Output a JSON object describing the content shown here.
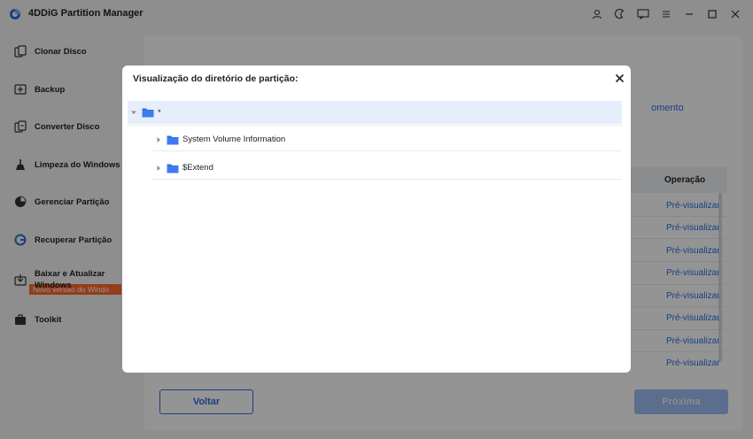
{
  "app": {
    "title": "4DDiG Partition Manager"
  },
  "sidebar": {
    "items": [
      {
        "label": "Clonar Disco",
        "icon": "clone-disk-icon"
      },
      {
        "label": "Backup",
        "icon": "backup-icon"
      },
      {
        "label": "Converter Disco",
        "icon": "convert-disk-icon"
      },
      {
        "label": "Limpeza do Windows",
        "icon": "windows-cleanup-icon"
      },
      {
        "label": "Gerenciar Partição",
        "icon": "pie-chart-icon"
      },
      {
        "label": "Recuperar Partição",
        "icon": "recover-partition-icon"
      },
      {
        "label": "Baixar e Atualizar Windows",
        "icon": "download-windows-icon"
      },
      {
        "label": "Toolkit",
        "icon": "toolkit-icon"
      }
    ],
    "badge": "Novo versão do Windo"
  },
  "main": {
    "behind_text": "omento",
    "operation_header": "Operação",
    "preview_label": "Pré-visualizar",
    "back_button": "Voltar",
    "next_button": "Próxima"
  },
  "modal": {
    "title": "Visualização do diretório de partição:",
    "tree": {
      "root": "*",
      "children": [
        "System Volume Information",
        "$Extend"
      ]
    }
  },
  "colors": {
    "accent": "#2b6fe0",
    "badge": "#ff6a2c",
    "folder": "#2f6fe4",
    "selected_row": "#e7eefb"
  }
}
